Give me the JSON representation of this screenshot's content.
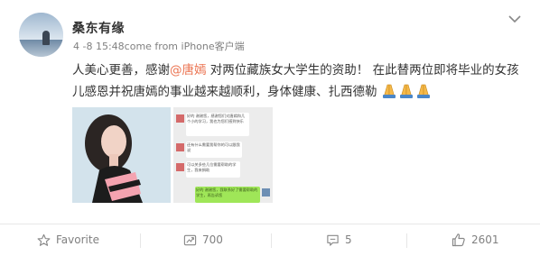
{
  "post": {
    "author": "桑东有缘",
    "meta": "4 -8 15:48come from iPhone客户端",
    "text_part1": "人美心更善，感谢",
    "mention": "@唐嫣",
    "text_part2": " 对两位藏族女大学生的资助！ 在此替两位即将毕业的女孩儿感恩并祝唐嫣的事业越来越顺利，身体健康、扎西德勒",
    "emoji": "praying-hands",
    "chat_lines": [
      "好的 谢谢您，感谢您们对唐嫣和几个小的学习，我也为您们感到快乐",
      "还有什么需要我帮你的可以跟我说",
      "可以关多些几位需要帮助的学生，我来捐助",
      "好的 谢谢您，我联系好了需要帮助的学生，再告诉您"
    ]
  },
  "actions": {
    "favorite": "Favorite",
    "repost": "700",
    "comment": "5",
    "like": "2601"
  },
  "colors": {
    "mention": "#eb7350",
    "text": "#333333",
    "muted": "#808080",
    "chat_bubble_green": "#9fe658"
  }
}
